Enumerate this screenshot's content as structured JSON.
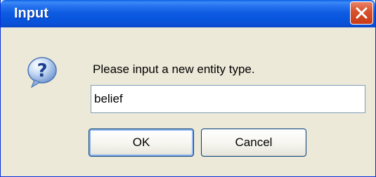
{
  "dialog": {
    "title": "Input",
    "prompt": "Please input a new entity type.",
    "input_value": "belief",
    "ok_label": "OK",
    "cancel_label": "Cancel",
    "icon": "question-icon"
  },
  "colors": {
    "titlebar": "#0a56d8",
    "close_button": "#d9532f",
    "dialog_background": "#ece9d8",
    "input_border": "#7f9db9",
    "button_border": "#003c74"
  }
}
